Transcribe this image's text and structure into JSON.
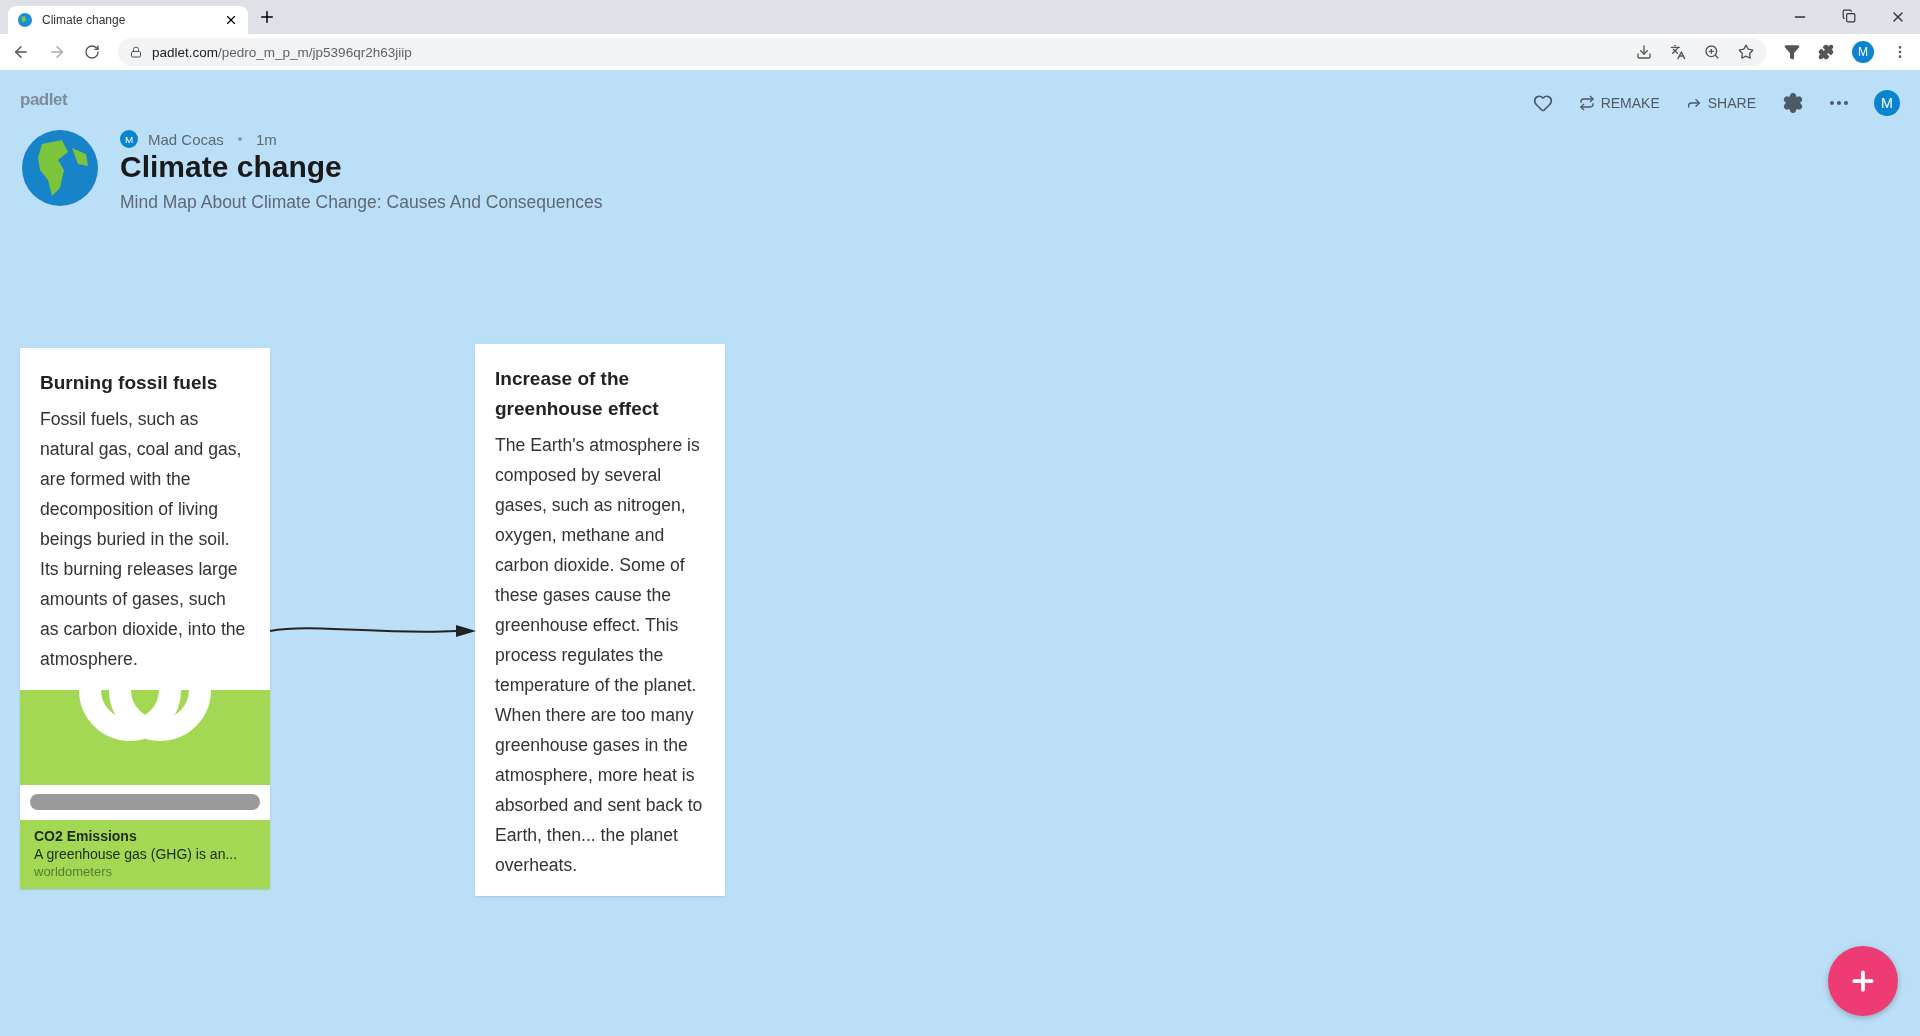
{
  "browser": {
    "tab_title": "Climate change",
    "url_host": "padlet.com",
    "url_path": "/pedro_m_p_m/jp5396qr2h63jiip",
    "profile_initial": "M"
  },
  "header": {
    "brand": "padlet",
    "author_initial": "M",
    "author": "Mad Cocas",
    "time": "1m",
    "title": "Climate change",
    "subtitle": "Mind Map About Climate Change: Causes And Consequences",
    "actions": [
      {
        "kind": "like"
      },
      {
        "kind": "remake",
        "label": "REMAKE"
      },
      {
        "kind": "share",
        "label": "SHARE"
      },
      {
        "kind": "settings"
      },
      {
        "kind": "more"
      }
    ],
    "user_initial": "M"
  },
  "posts": [
    {
      "title": "Burning fossil fuels",
      "body": "Fossil fuels, such as natural gas, coal and gas, are formed with the decomposition of living beings buried in the soil. Its burning releases large amounts of gases, such as carbon dioxide, into the atmosphere.",
      "attachment": {
        "title": "CO2 Emissions",
        "description": "A greenhouse gas (GHG) is an...",
        "source": "worldometers"
      }
    },
    {
      "title": "Increase of the greenhouse effect",
      "body": "The Earth's atmosphere is composed by several gases, such as nitrogen, oxygen, methane and carbon dioxide. Some of these gases cause the greenhouse effect. This process regulates the temperature of the planet. When there are too many greenhouse gases in the atmosphere, more heat is absorbed and sent back to Earth, then... the planet overheats."
    }
  ]
}
